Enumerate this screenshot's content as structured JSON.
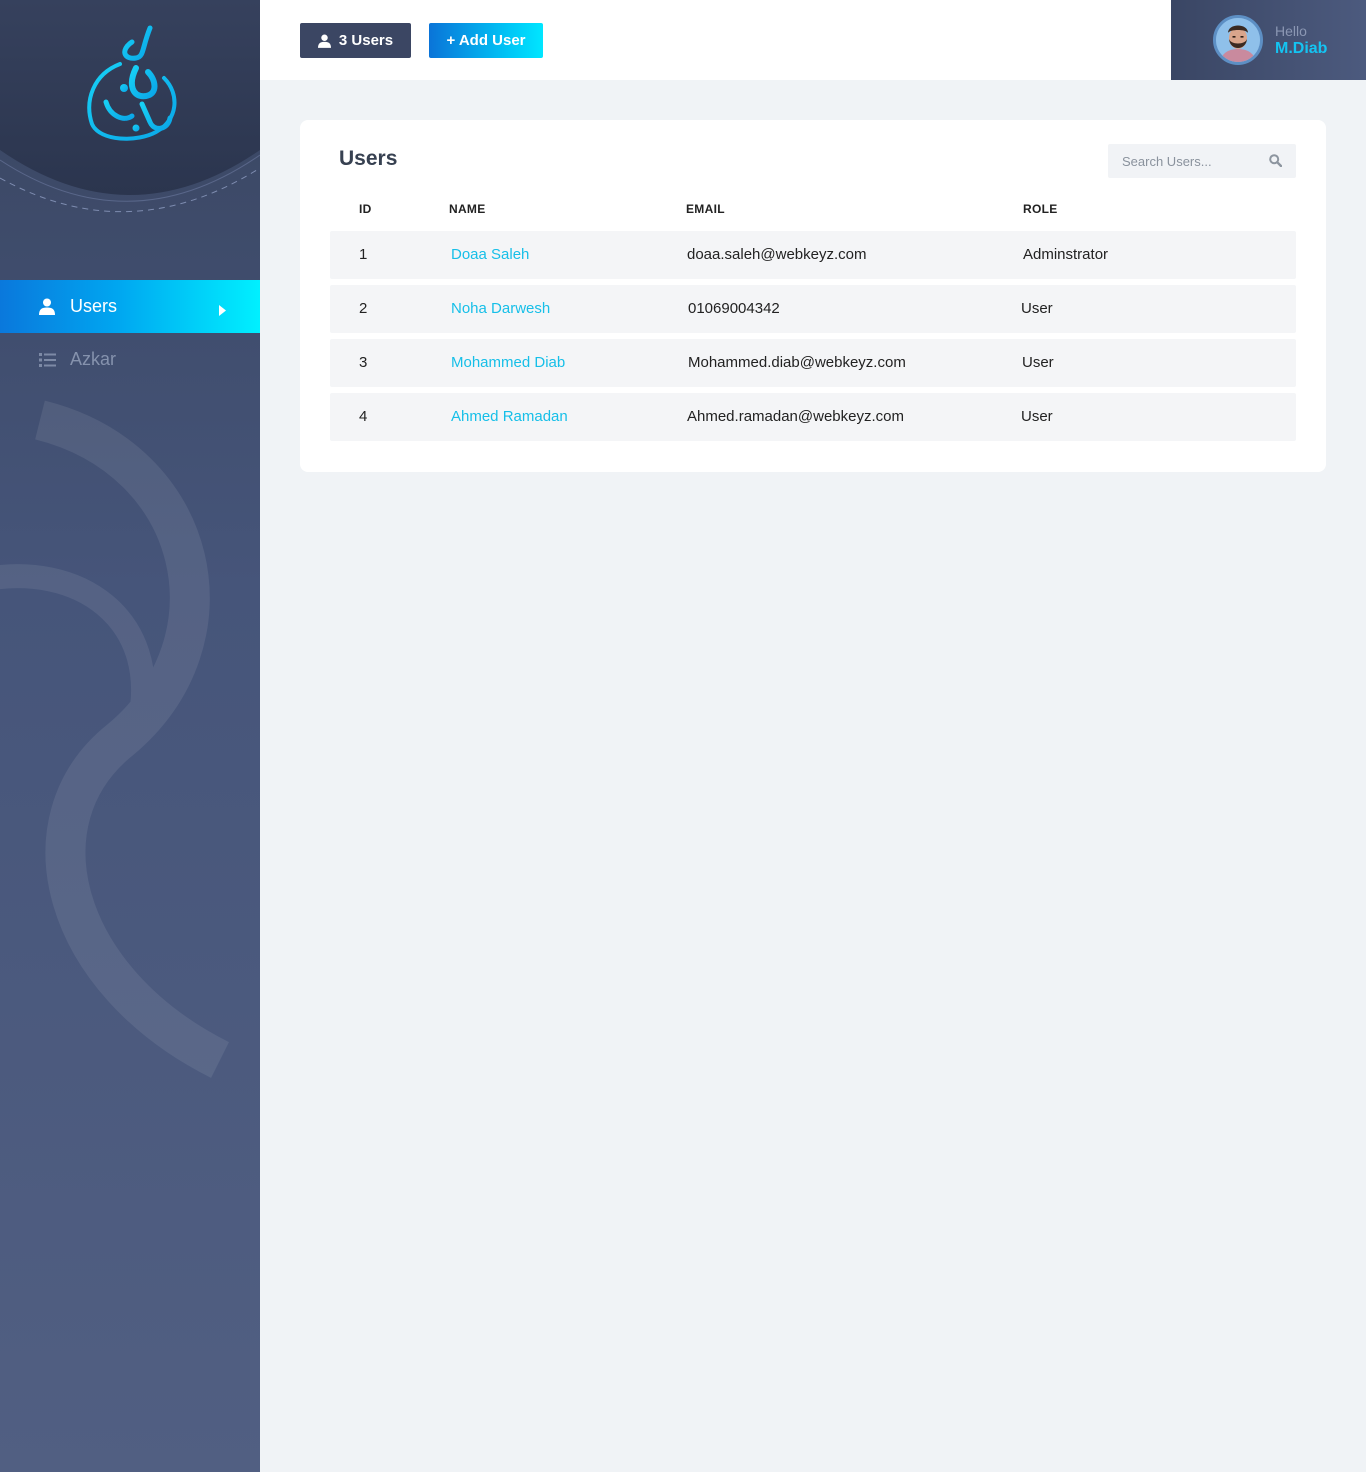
{
  "sidebar": {
    "items": [
      {
        "label": "Users",
        "icon": "user-icon",
        "active": true
      },
      {
        "label": "Azkar",
        "icon": "list-icon",
        "active": false
      }
    ]
  },
  "header": {
    "users_count_label": "3 Users",
    "add_user_label": "+ Add User"
  },
  "profile": {
    "greeting": "Hello",
    "name": "M.Diab"
  },
  "users_card": {
    "title": "Users",
    "search_placeholder": "Search Users...",
    "columns": [
      "ID",
      "NAME",
      "EMAIL",
      "ROLE"
    ],
    "rows": [
      {
        "id": "1",
        "name": "Doaa Saleh",
        "email": "doaa.saleh@webkeyz.com",
        "role": "Adminstrator"
      },
      {
        "id": "2",
        "name": "Noha Darwesh",
        "email": "01069004342",
        "role": "User"
      },
      {
        "id": "3",
        "name": "Mohammed Diab",
        "email": "Mohammed.diab@webkeyz.com",
        "role": "User"
      },
      {
        "id": "4",
        "name": "Ahmed Ramadan",
        "email": "Ahmed.ramadan@webkeyz.com",
        "role": "User"
      }
    ]
  },
  "colors": {
    "accent": "#16bfe8",
    "sidebar_bg": "#46557a",
    "dark_button": "#3b4663"
  }
}
